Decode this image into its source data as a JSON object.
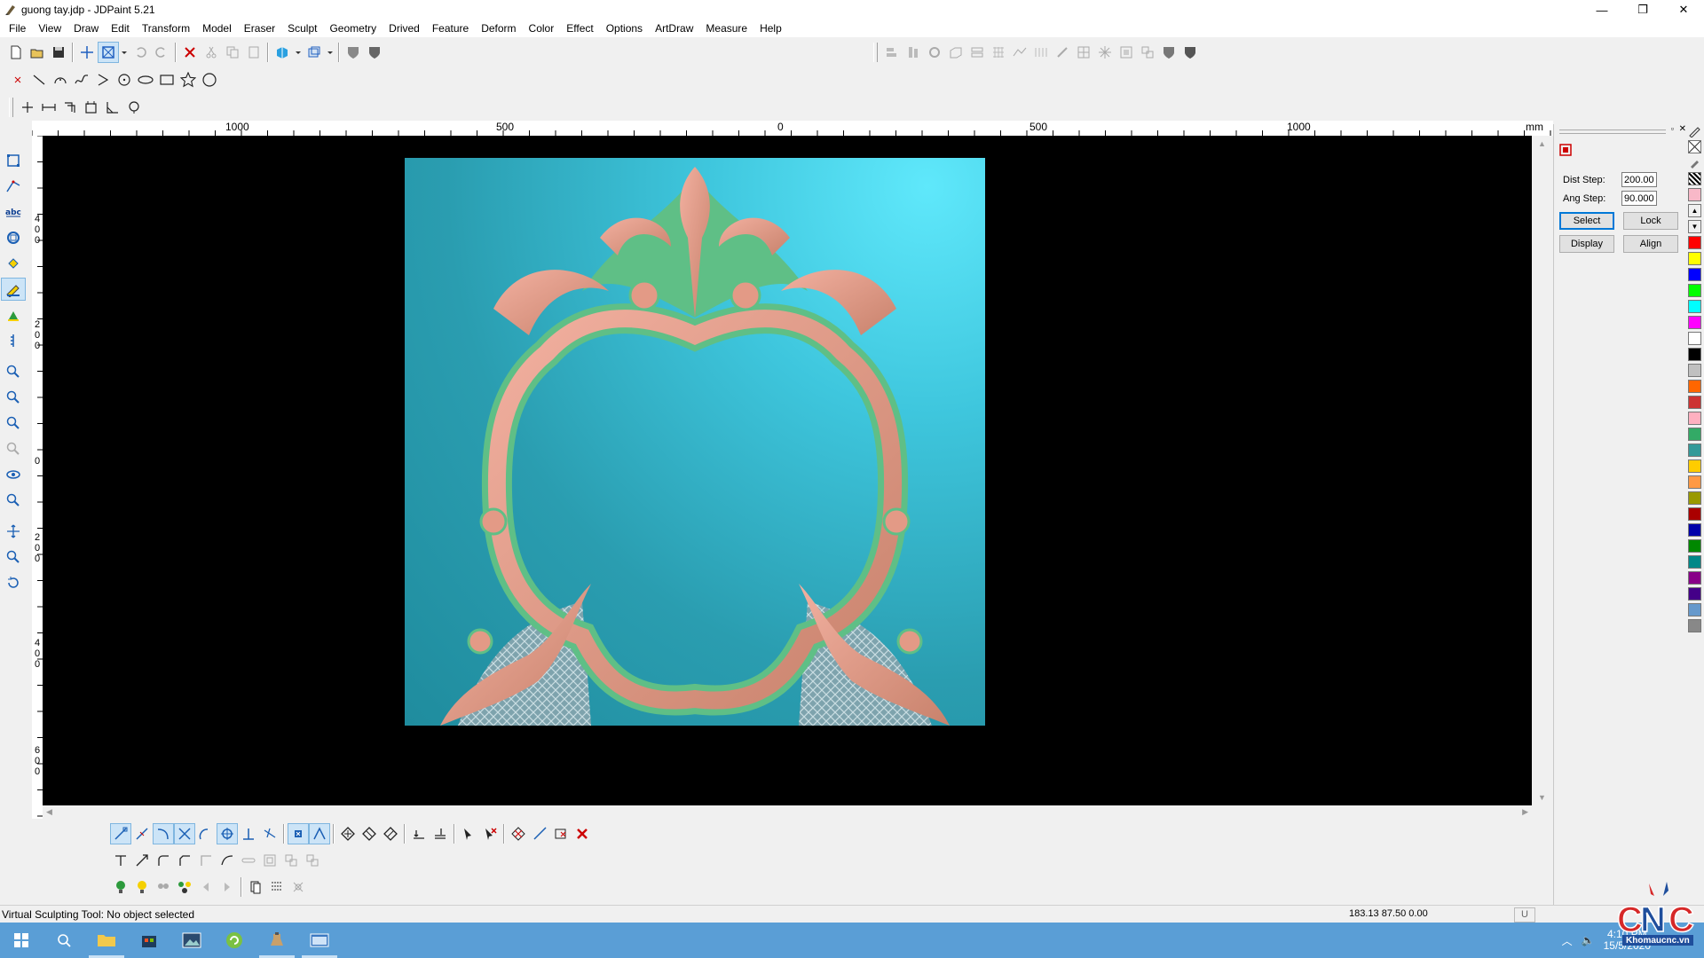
{
  "window": {
    "title": "guong tay.jdp - JDPaint 5.21",
    "controls": {
      "minimize": "—",
      "restore": "❐",
      "close": "✕"
    }
  },
  "menu": [
    "File",
    "View",
    "Draw",
    "Edit",
    "Transform",
    "Model",
    "Eraser",
    "Sculpt",
    "Geometry",
    "Drived",
    "Feature",
    "Deform",
    "Color",
    "Effect",
    "Options",
    "ArtDraw",
    "Measure",
    "Help"
  ],
  "ruler": {
    "unit": "mm",
    "top_labels": [
      "1000",
      "500",
      "0",
      "500",
      "1000"
    ],
    "left_labels": [
      [
        "4",
        "0",
        "0"
      ],
      [
        "2",
        "0",
        "0"
      ],
      [
        "0"
      ],
      [
        "2",
        "0",
        "0"
      ],
      [
        "4",
        "0",
        "0"
      ],
      [
        "6",
        "0",
        "0"
      ]
    ]
  },
  "panel": {
    "dist_step_label": "Dist Step:",
    "dist_step_value": "200.000",
    "ang_step_label": "Ang Step:",
    "ang_step_value": "90.000",
    "buttons": {
      "select": "Select",
      "lock": "Lock",
      "display": "Display",
      "align": "Align"
    }
  },
  "palette": [
    "#ff0000",
    "#ffff00",
    "#0000ff",
    "#00ff00",
    "#00ffff",
    "#ff00ff",
    "#ffffff",
    "#000000",
    "#c0c0c0",
    "#ff6600",
    "#cc3333",
    "#ffb0c0",
    "#33aa66",
    "#339999",
    "#ffcc00",
    "#ff9944",
    "#999900",
    "#aa0000",
    "#0000aa",
    "#008800",
    "#008888",
    "#880088",
    "#440088",
    "#6699cc",
    "#888888"
  ],
  "status": {
    "text": "Virtual Sculpting Tool: No object selected",
    "coords": "183.13 87.50 0.00",
    "unit": "U"
  },
  "taskbar": {
    "tray_time": "4:10 PM",
    "tray_date": "15/5/2020"
  },
  "watermark": {
    "logo": "CNC",
    "site": "Khomaucnc.vn"
  },
  "colors": {
    "accent": "#0078d7",
    "taskbar": "#5a9ed6",
    "viewport": "#000000",
    "relief": "#2fb3c8"
  }
}
